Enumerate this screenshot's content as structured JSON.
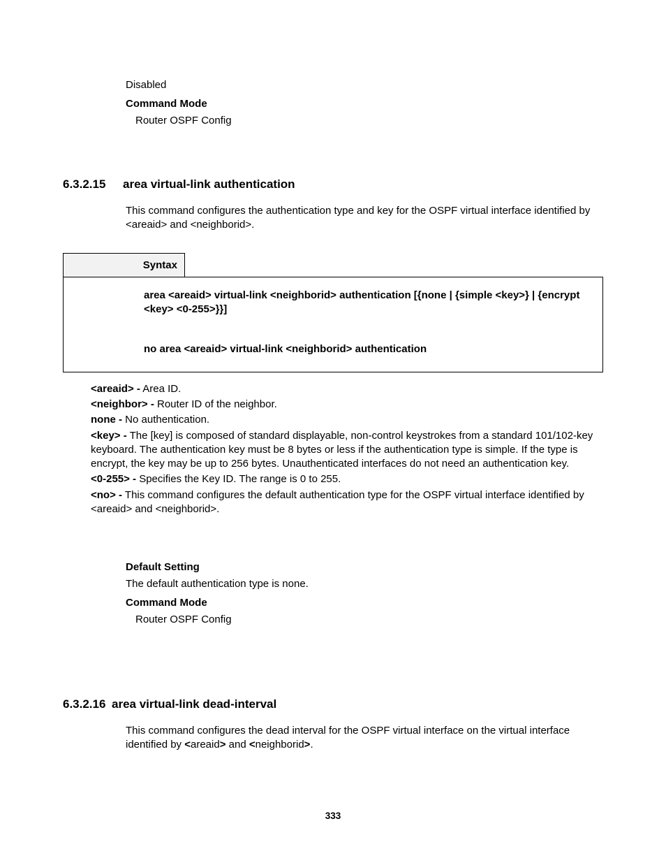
{
  "top": {
    "disabled": "Disabled",
    "command_mode_label": "Command Mode",
    "command_mode_value": "Router OSPF Config"
  },
  "section15": {
    "num": "6.3.2.15",
    "title": "area virtual-link authentication",
    "desc": "This command configures the authentication type and key for the OSPF virtual interface identified by <areaid> and <neighborid>.",
    "syntax_label": "Syntax",
    "syntax1": "area <areaid> virtual-link <neighborid> authentication [{none | {simple <key>} | {encrypt <key> <0-255>}}]",
    "syntax2": "no area <areaid> virtual-link <neighborid> authentication",
    "params": {
      "areaid_b": "<areaid> -",
      "areaid_t": " Area ID.",
      "neighbor_b": "<neighbor> -",
      "neighbor_t": " Router ID of the neighbor.",
      "none_b": "none -",
      "none_t": " No authentication.",
      "key_b": "<key> -",
      "key_t": " The [key] is composed of standard displayable, non-control keystrokes from a standard 101/102-key keyboard. The authentication key must be 8 bytes or less if the authentication type is simple. If the type is encrypt, the key may be up to 256 bytes. Unauthenticated interfaces do not need an authentication key.",
      "range_b": "<0-255> -",
      "range_t": " Specifies the Key ID. The range is 0 to 255.",
      "no_b": "<no> -",
      "no_t": " This command configures the default authentication type for the OSPF virtual interface identified by <areaid> and <neighborid>."
    },
    "default_setting_label": "Default Setting",
    "default_setting_value": "The default authentication type is none.",
    "command_mode_label": "Command Mode",
    "command_mode_value": "Router OSPF Config"
  },
  "section16": {
    "num": "6.3.2.16",
    "title": "area virtual-link dead-interval",
    "desc_pre": "This command configures the dead interval for the OSPF virtual interface on the virtual interface identified by ",
    "desc_b1": "<",
    "desc_mid1": "areaid",
    "desc_b2": ">",
    "desc_and": " and ",
    "desc_b3": "<",
    "desc_mid2": "neighborid",
    "desc_b4": ">",
    "desc_post": "."
  },
  "page_number": "333"
}
